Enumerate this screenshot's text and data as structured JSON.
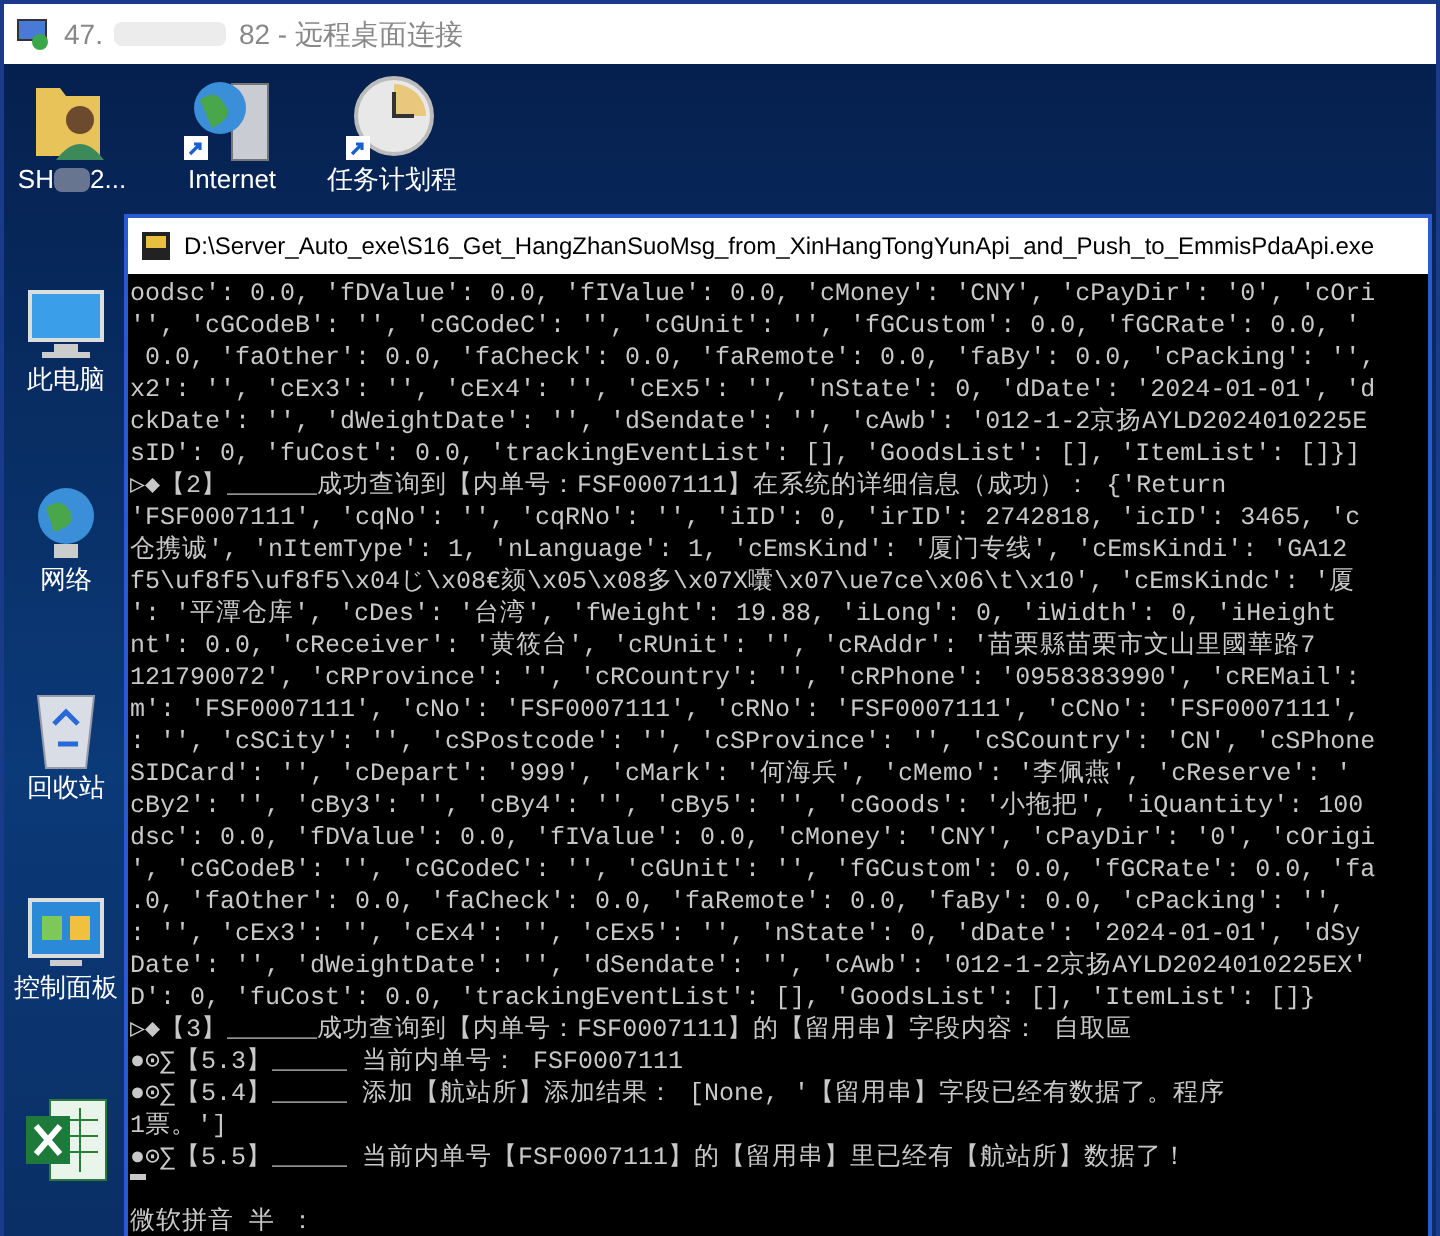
{
  "window": {
    "title_prefix": "47.",
    "title_suffix": "82 - 远程桌面连接"
  },
  "desktop_top_icons": [
    {
      "kind": "user-folder",
      "label": "SH",
      "label_suffix": "2..."
    },
    {
      "kind": "internet",
      "label": "Internet"
    },
    {
      "kind": "clock",
      "label": "任务计划程"
    }
  ],
  "desktop_side_icons": [
    {
      "kind": "computer",
      "label": "此电脑"
    },
    {
      "kind": "network",
      "label": "网络"
    },
    {
      "kind": "recycle",
      "label": "回收站"
    },
    {
      "kind": "control",
      "label": "控制面板"
    },
    {
      "kind": "excel"
    }
  ],
  "console": {
    "title": "D:\\Server_Auto_exe\\S16_Get_HangZhanSuoMsg_from_XinHangTongYunApi_and_Push_to_EmmisPdaApi.exe",
    "lines": [
      {
        "kind": "text",
        "text": "oodsc': 0.0, 'fDValue': 0.0, 'fIValue': 0.0, 'cMoney': 'CNY', 'cPayDir': '0', 'cOri"
      },
      {
        "kind": "text",
        "text": "'', 'cGCodeB': '', 'cGCodeC': '', 'cGUnit': '', 'fGCustom': 0.0, 'fGCRate': 0.0, '"
      },
      {
        "kind": "text",
        "text": " 0.0, 'faOther': 0.0, 'faCheck': 0.0, 'faRemote': 0.0, 'faBy': 0.0, 'cPacking': '',"
      },
      {
        "kind": "text",
        "text": "x2': '', 'cEx3': '', 'cEx4': '', 'cEx5': '', 'nState': 0, 'dDate': '2024-01-01', 'd"
      },
      {
        "kind": "text",
        "text": "ckDate': '', 'dWeightDate': '', 'dSendate': '', 'cAwb': '012-1-2京扬AYLD2024010225E"
      },
      {
        "kind": "text",
        "text": "sID': 0, 'fuCost': 0.0, 'trackingEventList': [], 'GoodsList': [], 'ItemList': []}]"
      },
      {
        "kind": "text",
        "text": "▷◆【2】______成功查询到【内单号：FSF0007111】在系统的详细信息（成功）： {'Return"
      },
      {
        "kind": "text",
        "text": "'FSF0007111', 'cqNo': '', 'cqRNo': '', 'iID': 0, 'irID': 2742818, 'icID': 3465, 'c"
      },
      {
        "kind": "text",
        "text": "仓携诚', 'nItemType': 1, 'nLanguage': 1, 'cEmsKind': '厦门专线', 'cEmsKindi': 'GA12"
      },
      {
        "kind": "text",
        "text": "f5\\uf8f5\\uf8f5\\x04じ\\x08€颏\\x05\\x08多\\x07X囔\\x07\\ue7ce\\x06\\t\\x10', 'cEmsKindc': '厦"
      },
      {
        "kind": "text",
        "text": "': '平潭仓库', 'cDes': '台湾', 'fWeight': 19.88, 'iLong': 0, 'iWidth': 0, 'iHeight"
      },
      {
        "kind": "text",
        "text": "nt': 0.0, 'cReceiver': '黄筱台', 'cRUnit': '', 'cRAddr': '苗栗縣苗栗市文山里國華路7"
      },
      {
        "kind": "text",
        "text": "121790072', 'cRProvince': '', 'cRCountry': '', 'cRPhone': '0958383990', 'cREMail':"
      },
      {
        "kind": "text",
        "text": "m': 'FSF0007111', 'cNo': 'FSF0007111', 'cRNo': 'FSF0007111', 'cCNo': 'FSF0007111',"
      },
      {
        "kind": "text",
        "text": ": '', 'cSCity': '', 'cSPostcode': '', 'cSProvince': '', 'cSCountry': 'CN', 'cSPhone"
      },
      {
        "kind": "text",
        "text": "SIDCard': '', 'cDepart': '999', 'cMark': '何海兵', 'cMemo': '李佩燕', 'cReserve': '"
      },
      {
        "kind": "text",
        "text": "cBy2': '', 'cBy3': '', 'cBy4': '', 'cBy5': '', 'cGoods': '小拖把', 'iQuantity': 100"
      },
      {
        "kind": "text",
        "text": "dsc': 0.0, 'fDValue': 0.0, 'fIValue': 0.0, 'cMoney': 'CNY', 'cPayDir': '0', 'cOrigi"
      },
      {
        "kind": "text",
        "text": "', 'cGCodeB': '', 'cGCodeC': '', 'cGUnit': '', 'fGCustom': 0.0, 'fGCRate': 0.0, 'fa"
      },
      {
        "kind": "text",
        "text": ".0, 'faOther': 0.0, 'faCheck': 0.0, 'faRemote': 0.0, 'faBy': 0.0, 'cPacking': '',"
      },
      {
        "kind": "text",
        "text": ": '', 'cEx3': '', 'cEx4': '', 'cEx5': '', 'nState': 0, 'dDate': '2024-01-01', 'dSy"
      },
      {
        "kind": "text",
        "text": "Date': '', 'dWeightDate': '', 'dSendate': '', 'cAwb': '012-1-2京扬AYLD2024010225EX'"
      },
      {
        "kind": "text",
        "text": "D': 0, 'fuCost': 0.0, 'trackingEventList': [], 'GoodsList': [], 'ItemList': []}"
      },
      {
        "kind": "text",
        "text": "▷◆【3】______成功查询到【内单号：FSF0007111】的【留用串】字段内容： 自取區"
      },
      {
        "kind": "text",
        "text": "●⊙∑【5.3】_____ 当前内单号： FSF0007111"
      },
      {
        "kind": "text",
        "text": "●⊙∑【5.4】_____ 添加【航站所】添加结果： [None, '【留用串】字段已经有数据了。程序"
      },
      {
        "kind": "text",
        "text": "1票。']"
      },
      {
        "kind": "text",
        "text": "●⊙∑【5.5】_____ 当前内单号【FSF0007111】的【留用串】里已经有【航站所】数据了！"
      },
      {
        "kind": "cursor"
      },
      {
        "kind": "text",
        "text": "微软拼音 半 ："
      }
    ]
  }
}
